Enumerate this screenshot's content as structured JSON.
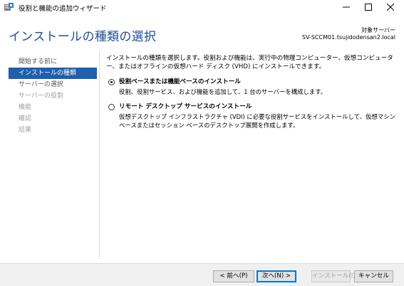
{
  "window": {
    "title": "役割と機能の追加ウィザード",
    "minimize_icon": "minimize-icon",
    "maximize_icon": "maximize-icon",
    "close_icon": "close-icon"
  },
  "header": {
    "page_title": "インストールの種類の選択",
    "target_label": "対象サーバー",
    "target_server": "SV-SCCM01.tsujidodensan2.local"
  },
  "sidebar": {
    "items": [
      {
        "label": "開始する前に",
        "state": "done"
      },
      {
        "label": "インストールの種類",
        "state": "active"
      },
      {
        "label": "サーバーの選択",
        "state": "next"
      },
      {
        "label": "サーバーの役割",
        "state": "disabled"
      },
      {
        "label": "機能",
        "state": "disabled"
      },
      {
        "label": "確認",
        "state": "disabled"
      },
      {
        "label": "結果",
        "state": "disabled"
      }
    ]
  },
  "main": {
    "intro": "インストールの種類を選択します。役割および機能は、実行中の物理コンピューター、仮想コンピューター、またはオフラインの仮想ハード ディスク (VHD) にインストールできます。",
    "options": [
      {
        "title": "役割ベースまたは機能ベースのインストール",
        "description": "役割、役割サービス、および機能を追加して、1 台のサーバーを構成します。",
        "selected": true
      },
      {
        "title": "リモート デスクトップ サービスのインストール",
        "description": "仮想デスクトップ インフラストラクチャ (VDI) に必要な役割サービスをインストールして、仮想マシン ベースまたはセッション ベースのデスクトップ展開を作成します。",
        "selected": false
      }
    ]
  },
  "footer": {
    "prev_label": "< 前へ(P)",
    "next_label": "次へ(N) >",
    "install_label": "インストール(I)",
    "cancel_label": "キャンセル"
  },
  "colors": {
    "accent": "#1e5fae",
    "title_blue": "#1e4e9a"
  }
}
